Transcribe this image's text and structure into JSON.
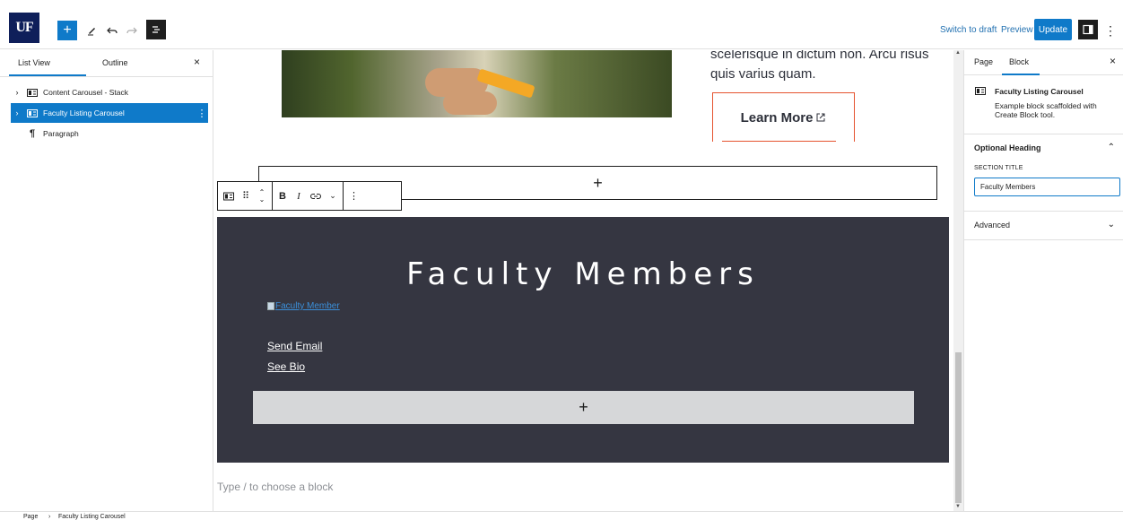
{
  "topbar": {
    "logo_text": "UF",
    "add_label": "+",
    "switch_to_draft": "Switch to draft",
    "preview": "Preview",
    "update": "Update",
    "icons": [
      "plus-icon",
      "pencil-icon",
      "undo-icon",
      "redo-icon",
      "list-view-icon",
      "sidebar-settings-icon",
      "more-options-icon"
    ],
    "accent_color": "#0f7ac9"
  },
  "left_panel": {
    "tabs": [
      {
        "label": "List View",
        "active": true
      },
      {
        "label": "Outline",
        "active": false
      }
    ],
    "close_label": "×",
    "tree": [
      {
        "label": "Content Carousel - Stack",
        "has_children": true,
        "selected": false,
        "icon": "block-icon"
      },
      {
        "label": "Faculty Listing Carousel",
        "has_children": true,
        "selected": true,
        "icon": "block-icon"
      },
      {
        "label": "Paragraph",
        "has_children": false,
        "selected": false,
        "icon": "paragraph-icon"
      }
    ]
  },
  "canvas": {
    "lorem_text": "scelerisque in dictum non. Arcu risus quis varius quam.",
    "learn_more": "Learn More",
    "inserter_plus": "+",
    "block_toolbar": {
      "bold": "B",
      "italic": "I"
    },
    "dark_block": {
      "title": "Faculty Members",
      "image_alt": "Faculty Member",
      "send_email": "Send Email",
      "see_bio": "See Bio",
      "inserter_plus": "+",
      "background": "#353641"
    },
    "placeholder": "Type / to choose a block"
  },
  "right_panel": {
    "tabs": [
      {
        "label": "Page",
        "active": false
      },
      {
        "label": "Block",
        "active": true
      }
    ],
    "close_label": "×",
    "block_card": {
      "title": "Faculty Listing Carousel",
      "description": "Example block scaffolded with Create Block tool."
    },
    "optional_heading": {
      "title": "Optional Heading",
      "field_label": "SECTION TITLE",
      "field_value": "Faculty Members"
    },
    "advanced": {
      "title": "Advanced"
    }
  },
  "footer": {
    "breadcrumb": [
      "Page",
      "Faculty Listing Carousel"
    ],
    "separator": "›"
  }
}
